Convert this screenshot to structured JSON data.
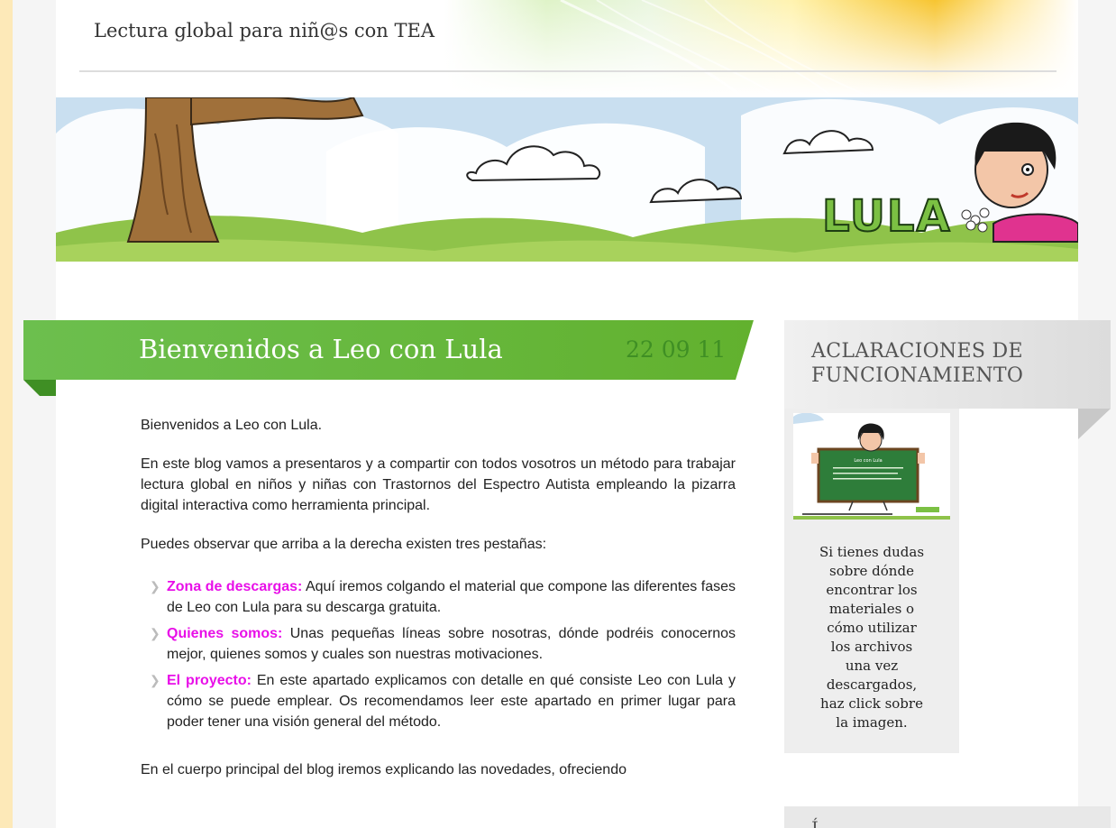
{
  "header": {
    "site_title": "Lectura global para niñ@s con TEA"
  },
  "banner": {
    "logo_text": "LULA"
  },
  "post": {
    "title": "Bienvenidos a Leo con Lula",
    "date": {
      "day": "22",
      "month": "09",
      "year": "11"
    },
    "paragraphs": [
      "Bienvenidos a Leo con Lula.",
      "En este blog vamos a presentaros y a compartir con todos vosotros un método para trabajar lectura global en niños y niñas con Trastornos del Espectro Autista empleando la pizarra digital interactiva como herramienta principal.",
      "Puedes observar que arriba a la derecha existen tres pestañas:"
    ],
    "tabs_list": [
      {
        "term": "Zona de descargas:",
        "text": " Aquí iremos colgando el material que compone las diferentes fases de Leo con Lula para su descarga gratuita."
      },
      {
        "term": "Quienes somos:",
        "text": " Unas pequeñas líneas sobre nosotras, dónde podréis conocernos mejor, quienes somos y cuales son nuestras motivaciones."
      },
      {
        "term": "El proyecto:",
        "text": " En este apartado explicamos con detalle en qué consiste Leo con Lula y cómo se puede emplear. Os recomendamos leer este apartado en primer lugar para poder tener una visión general del método."
      }
    ],
    "closing": "En el cuerpo principal del blog iremos explicando las novedades, ofreciendo"
  },
  "sidebar": {
    "widget_title_line1": "ACLARACIONES DE",
    "widget_title_line2": "FUNCIONAMIENTO",
    "widget_image_title": "Leo con Lula",
    "widget_text_lines": [
      "Si tienes dudas",
      "sobre dónde",
      "encontrar los",
      "materiales o",
      "cómo utilizar",
      "los archivos",
      "una vez",
      "descargados,",
      "haz click sobre",
      "la imagen."
    ],
    "next_widget_title": "Í"
  },
  "colors": {
    "ribbon_green": "#6cbf3b",
    "ribbon_dark": "#3f8f24",
    "accent_magenta": "#e80fe8",
    "page_border": "#fde9b8"
  }
}
